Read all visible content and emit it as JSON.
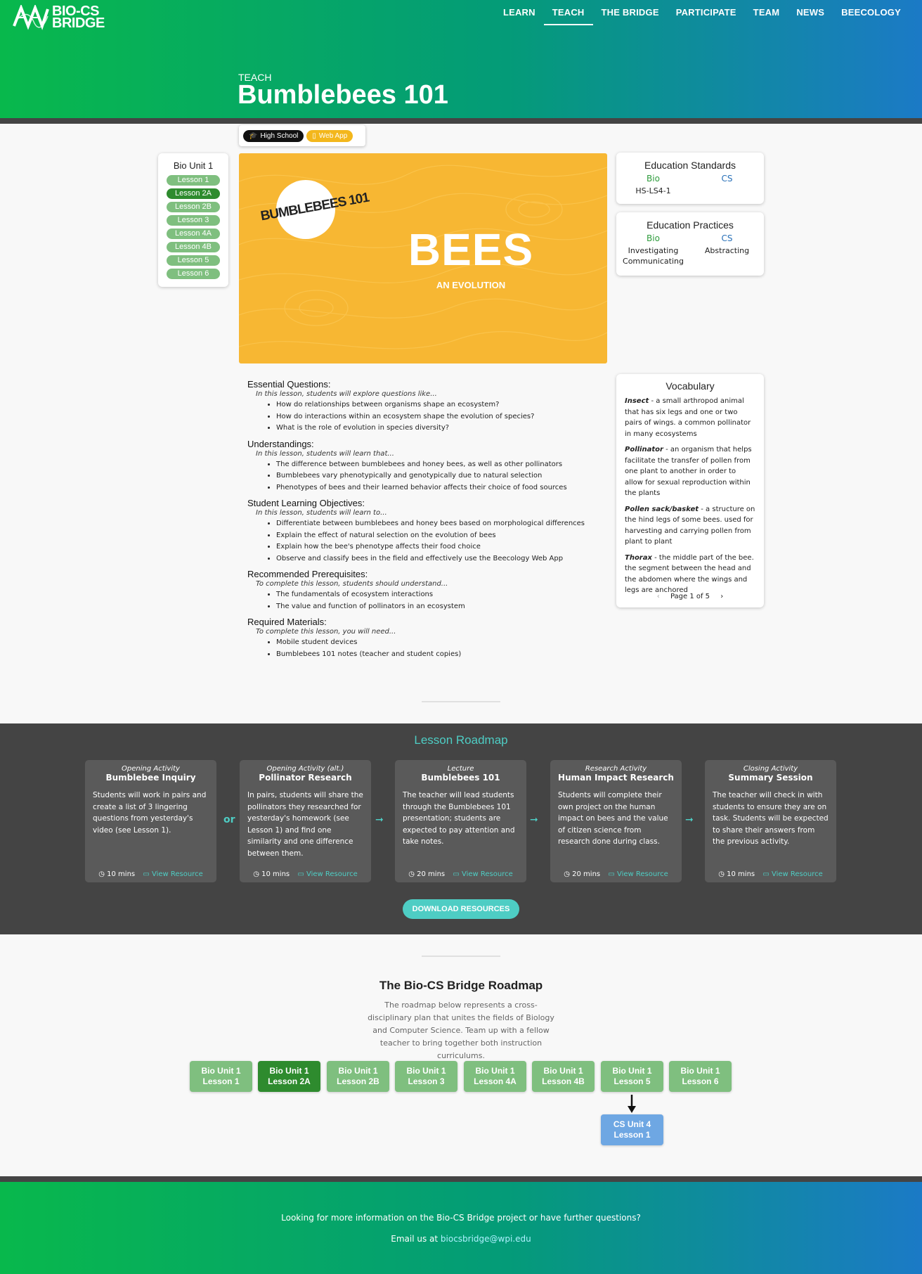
{
  "brand": {
    "name_line1": "BIO-CS",
    "name_line2": "BRIDGE"
  },
  "nav": [
    "LEARN",
    "TEACH",
    "THE BRIDGE",
    "PARTICIPATE",
    "TEAM",
    "NEWS",
    "BEECOLOGY"
  ],
  "nav_active": "TEACH",
  "breadcrumb": "TEACH",
  "page_title": "Bumblebees 101",
  "tags": {
    "level": "High School",
    "app": "Web App"
  },
  "unit": {
    "title": "Bio Unit 1",
    "lessons": [
      "Lesson 1",
      "Lesson 2A",
      "Lesson 2B",
      "Lesson 3",
      "Lesson 4A",
      "Lesson 4B",
      "Lesson 5",
      "Lesson 6"
    ],
    "active_index": 1
  },
  "hero": {
    "badge": "BUMBLEBEES 101",
    "title": "BEES",
    "subtitle": "AN EVOLUTION"
  },
  "standards": {
    "title": "Education Standards",
    "bio_label": "Bio",
    "cs_label": "CS",
    "bio_items": [
      "HS-LS4-1"
    ],
    "cs_items": []
  },
  "practices": {
    "title": "Education Practices",
    "bio_label": "Bio",
    "cs_label": "CS",
    "bio_items": [
      "Investigating",
      "Communicating"
    ],
    "cs_items": [
      "Abstracting"
    ]
  },
  "lesson_sections": [
    {
      "heading": "Essential Questions:",
      "intro": "In this lesson, students will explore questions like...",
      "items": [
        "How do relationships between organisms shape an ecosystem?",
        "How do interactions within an ecosystem shape the evolution of species?",
        "What is the role of evolution in species diversity?"
      ]
    },
    {
      "heading": "Understandings:",
      "intro": "In this lesson, students will learn that...",
      "items": [
        "The difference between bumblebees and honey bees, as well as other pollinators",
        "Bumblebees vary phenotypically and genotypically due to natural selection",
        "Phenotypes of bees and their learned behavior affects their choice of food sources"
      ]
    },
    {
      "heading": "Student Learning Objectives:",
      "intro": "In this lesson, students will learn to...",
      "items": [
        "Differentiate between bumblebees and honey bees based on morphological differences",
        "Explain the effect of natural selection on the evolution of bees",
        "Explain how the bee's phenotype affects their food choice",
        "Observe and classify bees in the field and effectively use the Beecology Web App"
      ]
    },
    {
      "heading": "Recommended Prerequisites:",
      "intro": "To complete this lesson, students should understand...",
      "items": [
        "The fundamentals of ecosystem interactions",
        "The value and function of pollinators in an ecosystem"
      ]
    },
    {
      "heading": "Required Materials:",
      "intro": "To complete this lesson, you will need...",
      "items": [
        "Mobile student devices",
        "Bumblebees 101 notes (teacher and student copies)"
      ]
    }
  ],
  "vocabulary": {
    "title": "Vocabulary",
    "terms": [
      {
        "term": "Insect",
        "def": " - a small arthropod animal that has six legs and one or two pairs of wings. a common pollinator in many ecosystems"
      },
      {
        "term": "Pollinator",
        "def": " - an organism that helps facilitate the transfer of pollen from one plant to another in order to allow for sexual reproduction within the plants"
      },
      {
        "term": "Pollen sack/basket",
        "def": " - a structure on the hind legs of some bees. used for harvesting and carrying pollen from plant to plant"
      },
      {
        "term": "Thorax",
        "def": " - the middle part of the bee. the segment between the head and the abdomen where the wings and legs are anchored"
      }
    ],
    "pager": "Page 1 of 5"
  },
  "lesson_roadmap": {
    "title": "Lesson Roadmap",
    "activities": [
      {
        "kind": "Opening Activity",
        "name": "Bumblebee Inquiry",
        "desc": "Students will work in pairs and create a list of 3 lingering questions from yesterday's video (see Lesson 1).",
        "time": "10 mins",
        "link": "View Resource"
      },
      {
        "kind": "Opening Activity (alt.)",
        "name": "Pollinator Research",
        "desc": "In pairs, students will share the pollinators they researched for yesterday's homework (see Lesson 1) and find one similarity and one difference between them.",
        "time": "10 mins",
        "link": "View Resource"
      },
      {
        "kind": "Lecture",
        "name": "Bumblebees 101",
        "desc": "The teacher will lead students through the Bumblebees 101 presentation; students are expected to pay attention and take notes.",
        "time": "20 mins",
        "link": "View Resource"
      },
      {
        "kind": "Research Activity",
        "name": "Human Impact Research",
        "desc": "Students will complete their own project on the human impact on bees and the value of citizen science from research done during class.",
        "time": "20 mins",
        "link": "View Resource"
      },
      {
        "kind": "Closing Activity",
        "name": "Summary Session",
        "desc": "The teacher will check in with students to ensure they are on task. Students will be expected to share their answers from the previous activity.",
        "time": "10 mins",
        "link": "View Resource"
      }
    ],
    "or_label": "or",
    "download": "DOWNLOAD RESOURCES"
  },
  "bridge_roadmap": {
    "title": "The Bio-CS Bridge Roadmap",
    "desc": "The roadmap below represents a cross-disciplinary plan that unites the fields of Biology and Computer Science. Team up with a fellow teacher to bring together both instruction curriculums.",
    "nodes": [
      {
        "l1": "Bio Unit 1",
        "l2": "Lesson 1"
      },
      {
        "l1": "Bio Unit 1",
        "l2": "Lesson 2A"
      },
      {
        "l1": "Bio Unit 1",
        "l2": "Lesson 2B"
      },
      {
        "l1": "Bio Unit 1",
        "l2": "Lesson 3"
      },
      {
        "l1": "Bio Unit 1",
        "l2": "Lesson 4A"
      },
      {
        "l1": "Bio Unit 1",
        "l2": "Lesson 4B"
      },
      {
        "l1": "Bio Unit 1",
        "l2": "Lesson 5"
      },
      {
        "l1": "Bio Unit 1",
        "l2": "Lesson 6"
      }
    ],
    "cs_node": {
      "l1": "CS Unit 4",
      "l2": "Lesson 1"
    }
  },
  "footer": {
    "line1": "Looking for more information on the Bio-CS Bridge project or have further questions?",
    "line2_prefix": "Email us at ",
    "email": "biocsbridge@wpi.edu"
  },
  "colors": {
    "green": "#08b84c",
    "teal": "#4ecdc4",
    "blue": "#1b7ac6",
    "hero": "#f7b733",
    "pill": "#7fbf7f",
    "pill_active": "#2e8b2e",
    "cs_node": "#6ea7e3"
  }
}
